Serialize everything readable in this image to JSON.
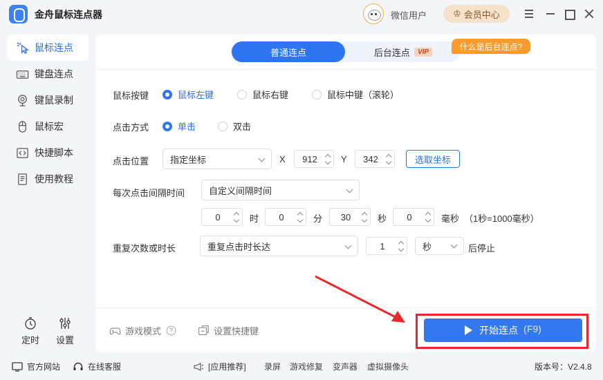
{
  "app": {
    "title": "金舟鼠标连点器"
  },
  "header": {
    "user_name": "微信用户",
    "vip_label": "会员中心",
    "icons": [
      "menu-icon",
      "minimize-icon",
      "maximize-icon",
      "close-icon"
    ]
  },
  "sidebar": {
    "items": [
      {
        "label": "鼠标连点",
        "icon": "mouse-click-icon",
        "active": true
      },
      {
        "label": "键盘连点",
        "icon": "keyboard-icon",
        "active": false
      },
      {
        "label": "键鼠录制",
        "icon": "record-icon",
        "active": false
      },
      {
        "label": "鼠标宏",
        "icon": "mouse-icon",
        "active": false
      },
      {
        "label": "快捷脚本",
        "icon": "script-icon",
        "active": false
      },
      {
        "label": "使用教程",
        "icon": "tutorial-icon",
        "active": false
      }
    ],
    "bottom": [
      {
        "label": "定时",
        "icon": "timer-icon"
      },
      {
        "label": "设置",
        "icon": "settings-icon"
      }
    ]
  },
  "main": {
    "tabs": [
      {
        "label": "普通连点",
        "active": true
      },
      {
        "label": "后台连点",
        "badge": "VIP",
        "active": false
      }
    ],
    "tip": "什么是后台连点?",
    "mouse_button": {
      "label": "鼠标按键",
      "options": [
        "鼠标左键",
        "鼠标右键",
        "鼠标中键（滚轮）"
      ],
      "selected": "鼠标左键"
    },
    "click_mode": {
      "label": "点击方式",
      "options": [
        "单击",
        "双击"
      ],
      "selected": "单击"
    },
    "position": {
      "label": "点击位置",
      "mode": "指定坐标",
      "x_label": "X",
      "x": "912",
      "y_label": "Y",
      "y": "342",
      "pick_button": "选取坐标"
    },
    "interval": {
      "label": "每次点击间隔时间",
      "mode": "自定义间隔时间",
      "hours": "0",
      "hours_unit": "时",
      "minutes": "0",
      "minutes_unit": "分",
      "seconds": "30",
      "seconds_unit": "秒",
      "ms": "0",
      "ms_unit": "毫秒",
      "hint": "（1秒=1000毫秒）"
    },
    "repeat": {
      "label": "重复次数或时长",
      "mode": "重复点击时长达",
      "value": "1",
      "unit": "秒",
      "suffix": "后停止"
    },
    "footer": {
      "game_mode": "游戏模式",
      "hotkey_settings": "设置快捷键",
      "start_button": "开始连点",
      "start_hotkey": "(F9)"
    }
  },
  "statusbar": {
    "official_site": "官方网站",
    "online_service": "在线客服",
    "recommend": "[应用推荐]",
    "links": [
      "录屏",
      "游戏修复",
      "变声器",
      "虚拟摄像头"
    ],
    "version": "版本号：V2.4.8"
  },
  "colors": {
    "accent": "#2f74f0",
    "highlight": "#e8282d",
    "vip_bg": "#f6e1cb",
    "tip_bg": "#fb9b2d"
  }
}
